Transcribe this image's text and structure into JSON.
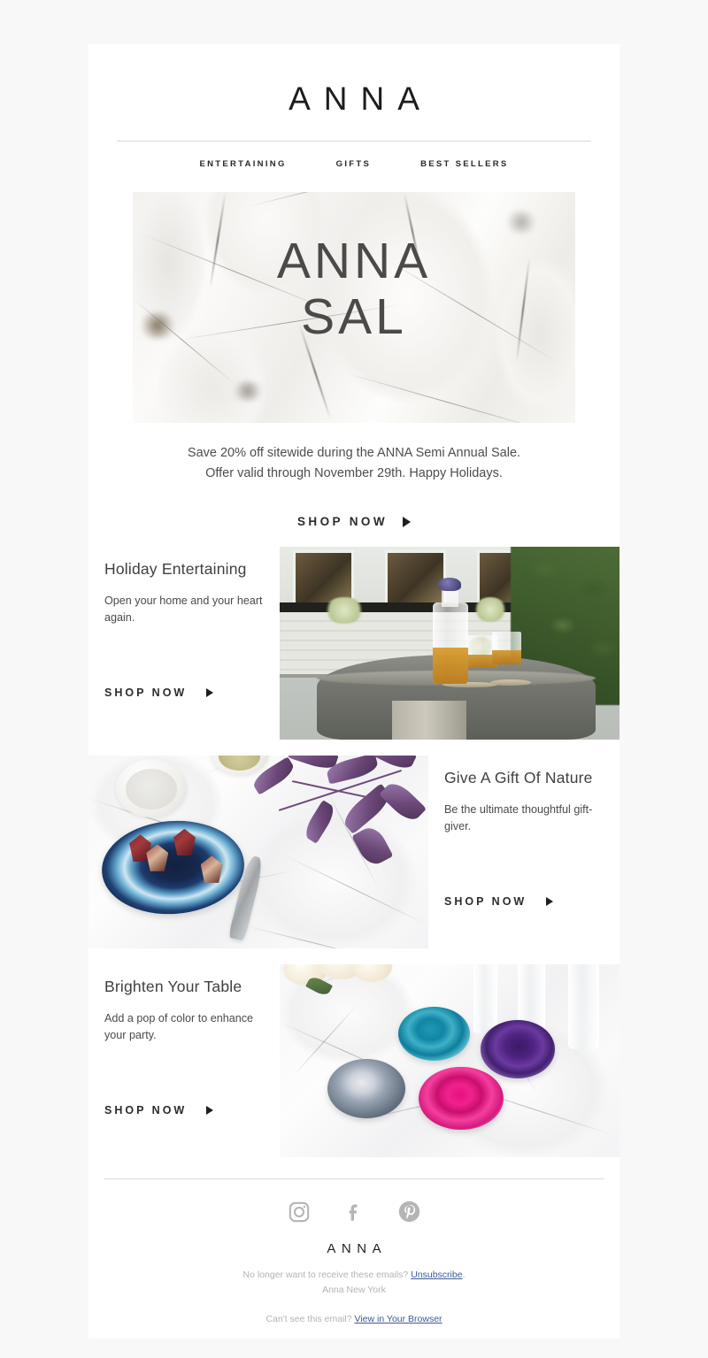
{
  "colors": {
    "page_background": "#f8f8f8",
    "card_background": "#ffffff",
    "text_dark": "#1d1d1d",
    "text_body": "#4d4d4d",
    "muted": "#b3b3b3",
    "link_blue": "#3d5a96",
    "hero_text": "#4a4a48",
    "rule": "#d8d8d8"
  },
  "header": {
    "logo": "ANNA",
    "nav": [
      {
        "label": "ENTERTAINING",
        "name": "nav-entertaining"
      },
      {
        "label": "GIFTS",
        "name": "nav-gifts"
      },
      {
        "label": "BEST SELLERS",
        "name": "nav-best-sellers"
      }
    ]
  },
  "hero": {
    "title_line1": "ANNA",
    "title_line2": "SAL",
    "image_alt": "white marble stone texture background"
  },
  "promo": {
    "line1": "Save 20% off sitewide during the ANNA Semi Annual Sale.",
    "line2": "Offer valid through November 29th. Happy Holidays.",
    "cta_label": "SHOP NOW"
  },
  "sections": [
    {
      "name": "holiday-entertaining",
      "title": "Holiday Entertaining",
      "description": "Open your home and your heart again.",
      "cta_label": "SHOP NOW",
      "image_alt": "whiskey decanter and glasses on stone patio table",
      "image_side": "right"
    },
    {
      "name": "give-a-gift-of-nature",
      "title": "Give A Gift Of Nature",
      "description": "Be the ultimate thoughtful gift-giver.",
      "cta_label": "SHOP NOW",
      "image_alt": "blue agate plate with chocolates on white marble",
      "image_side": "left"
    },
    {
      "name": "brighten-your-table",
      "title": "Brighten Your Table",
      "description": "Add a pop of color to enhance your party.",
      "cta_label": "SHOP NOW",
      "image_alt": "four colored agate coasters on white marble",
      "image_side": "right"
    }
  ],
  "footer": {
    "social": [
      {
        "name": "instagram-icon",
        "label": "Instagram"
      },
      {
        "name": "facebook-icon",
        "label": "Facebook"
      },
      {
        "name": "pinterest-icon",
        "label": "Pinterest"
      }
    ],
    "logo": "ANNA",
    "unsubscribe_prefix": "No longer want to receive these emails? ",
    "unsubscribe_link": "Unsubscribe",
    "unsubscribe_suffix": ".",
    "company": "Anna New York",
    "browser_prefix": "Can't see this email? ",
    "browser_link": "View in Your Browser"
  }
}
